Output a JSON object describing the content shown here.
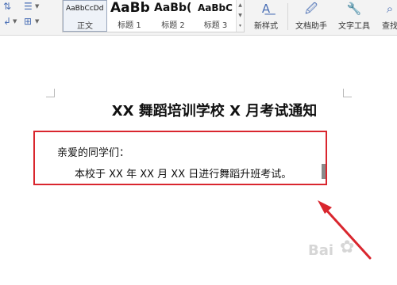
{
  "ribbon": {
    "styles": [
      {
        "sample": "AaBbCcDd",
        "label": "正文"
      },
      {
        "sample": "AaBb",
        "label": "标题 1"
      },
      {
        "sample": "AaBb(",
        "label": "标题 2"
      },
      {
        "sample": "AaBbC",
        "label": "标题 3"
      }
    ],
    "new_style_label": "新样式",
    "doc_assistant_label": "文档助手",
    "text_tools_label": "文字工具",
    "find_label": "查找"
  },
  "document": {
    "title": "XX 舞蹈培训学校 X 月考试通知",
    "greeting": "亲爱的同学们：",
    "body": "本校于 XX 年 XX 月 XX 日进行舞蹈升班考试。"
  },
  "watermark": "Bai",
  "colors": {
    "highlight": "#d9262e",
    "arrow": "#d9262e",
    "icon_accent": "#4a6fb5"
  },
  "icons": [
    "sort-icon",
    "borders-icon",
    "align-icon",
    "new-style-icon",
    "doc-assistant-icon",
    "text-tools-icon",
    "find-icon"
  ]
}
